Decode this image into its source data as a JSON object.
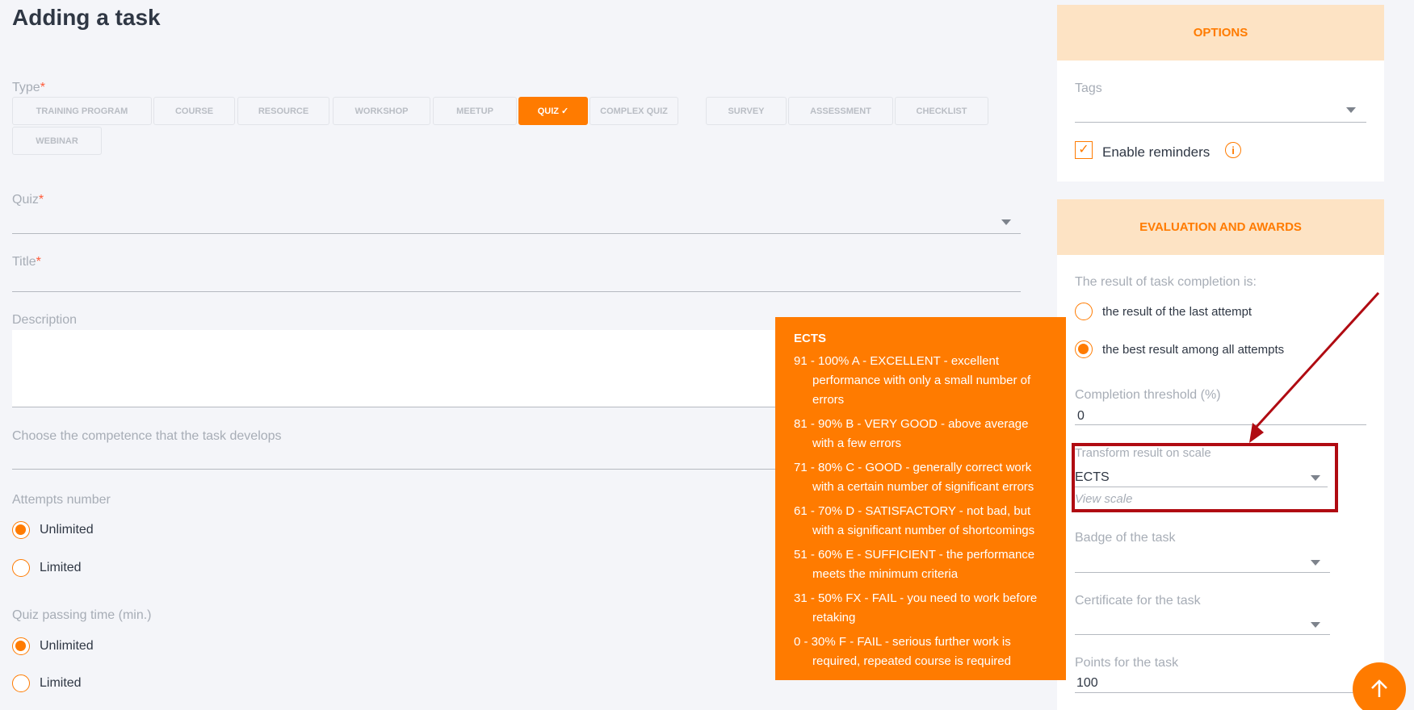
{
  "page": {
    "title": "Adding a task"
  },
  "form": {
    "type_label": "Type",
    "required_mark": "*",
    "type_options": [
      {
        "label": "TRAINING PROGRAM"
      },
      {
        "label": "COURSE"
      },
      {
        "label": "RESOURCE"
      },
      {
        "label": "WORKSHOP"
      },
      {
        "label": "MEETUP"
      },
      {
        "label": "QUIZ ✓"
      },
      {
        "label": "COMPLEX QUIZ"
      },
      {
        "label": "SURVEY"
      },
      {
        "label": "ASSESSMENT"
      },
      {
        "label": "CHECKLIST"
      },
      {
        "label": "WEBINAR"
      }
    ],
    "selected_type": "QUIZ",
    "quiz_label": "Quiz",
    "title_label": "Title",
    "description_label": "Description",
    "competence_label": "Choose the competence that the task develops",
    "attempts_label": "Attempts number",
    "attempts_options": [
      "Unlimited",
      "Limited"
    ],
    "attempts_selected": "Unlimited",
    "passing_time_label": "Quiz passing time (min.)",
    "passing_time_options": [
      "Unlimited",
      "Limited"
    ],
    "passing_time_selected": "Unlimited"
  },
  "options": {
    "header": "OPTIONS",
    "tags_label": "Tags",
    "enable_reminders_label": "Enable reminders",
    "enable_reminders_checked": true
  },
  "evaluation": {
    "header": "EVALUATION AND AWARDS",
    "result_label": "The result of task completion is:",
    "result_options": [
      "the result of the last attempt",
      "the best result among all attempts"
    ],
    "result_selected": "the best result among all attempts",
    "threshold_label": "Completion threshold (%)",
    "threshold_value": "0",
    "transform_label": "Transform result on scale",
    "transform_value": "ECTS",
    "view_scale_link": "View scale",
    "badge_label": "Badge of the task",
    "certificate_label": "Certificate for the task",
    "points_label": "Points for the task",
    "points_value": "100"
  },
  "tooltip": {
    "title": "ECTS",
    "items": [
      "91 - 100% A - EXCELLENT - excellent performance with only a small number of errors",
      "81 - 90% B - VERY GOOD - above average with a few errors",
      "71 - 80% C - GOOD - generally correct work with a certain number of significant errors",
      "61 - 70% D - SATISFACTORY - not bad, but with a significant number of shortcomings",
      "51 - 60% E - SUFFICIENT - the performance meets the minimum criteria",
      "31 - 50% FX - FAIL - you need to work before retaking",
      "0 - 30% F - FAIL - serious further work is required, repeated course is required"
    ]
  },
  "colors": {
    "accent": "#ff7b00",
    "panel_header_bg": "#fde3c4",
    "annotation_red": "#b00b12",
    "background": "#f4f5f9"
  },
  "icons": {
    "check": "check-icon",
    "info": "info-icon",
    "caret": "chevron-down-icon",
    "scroll_top": "arrow-up-icon"
  }
}
